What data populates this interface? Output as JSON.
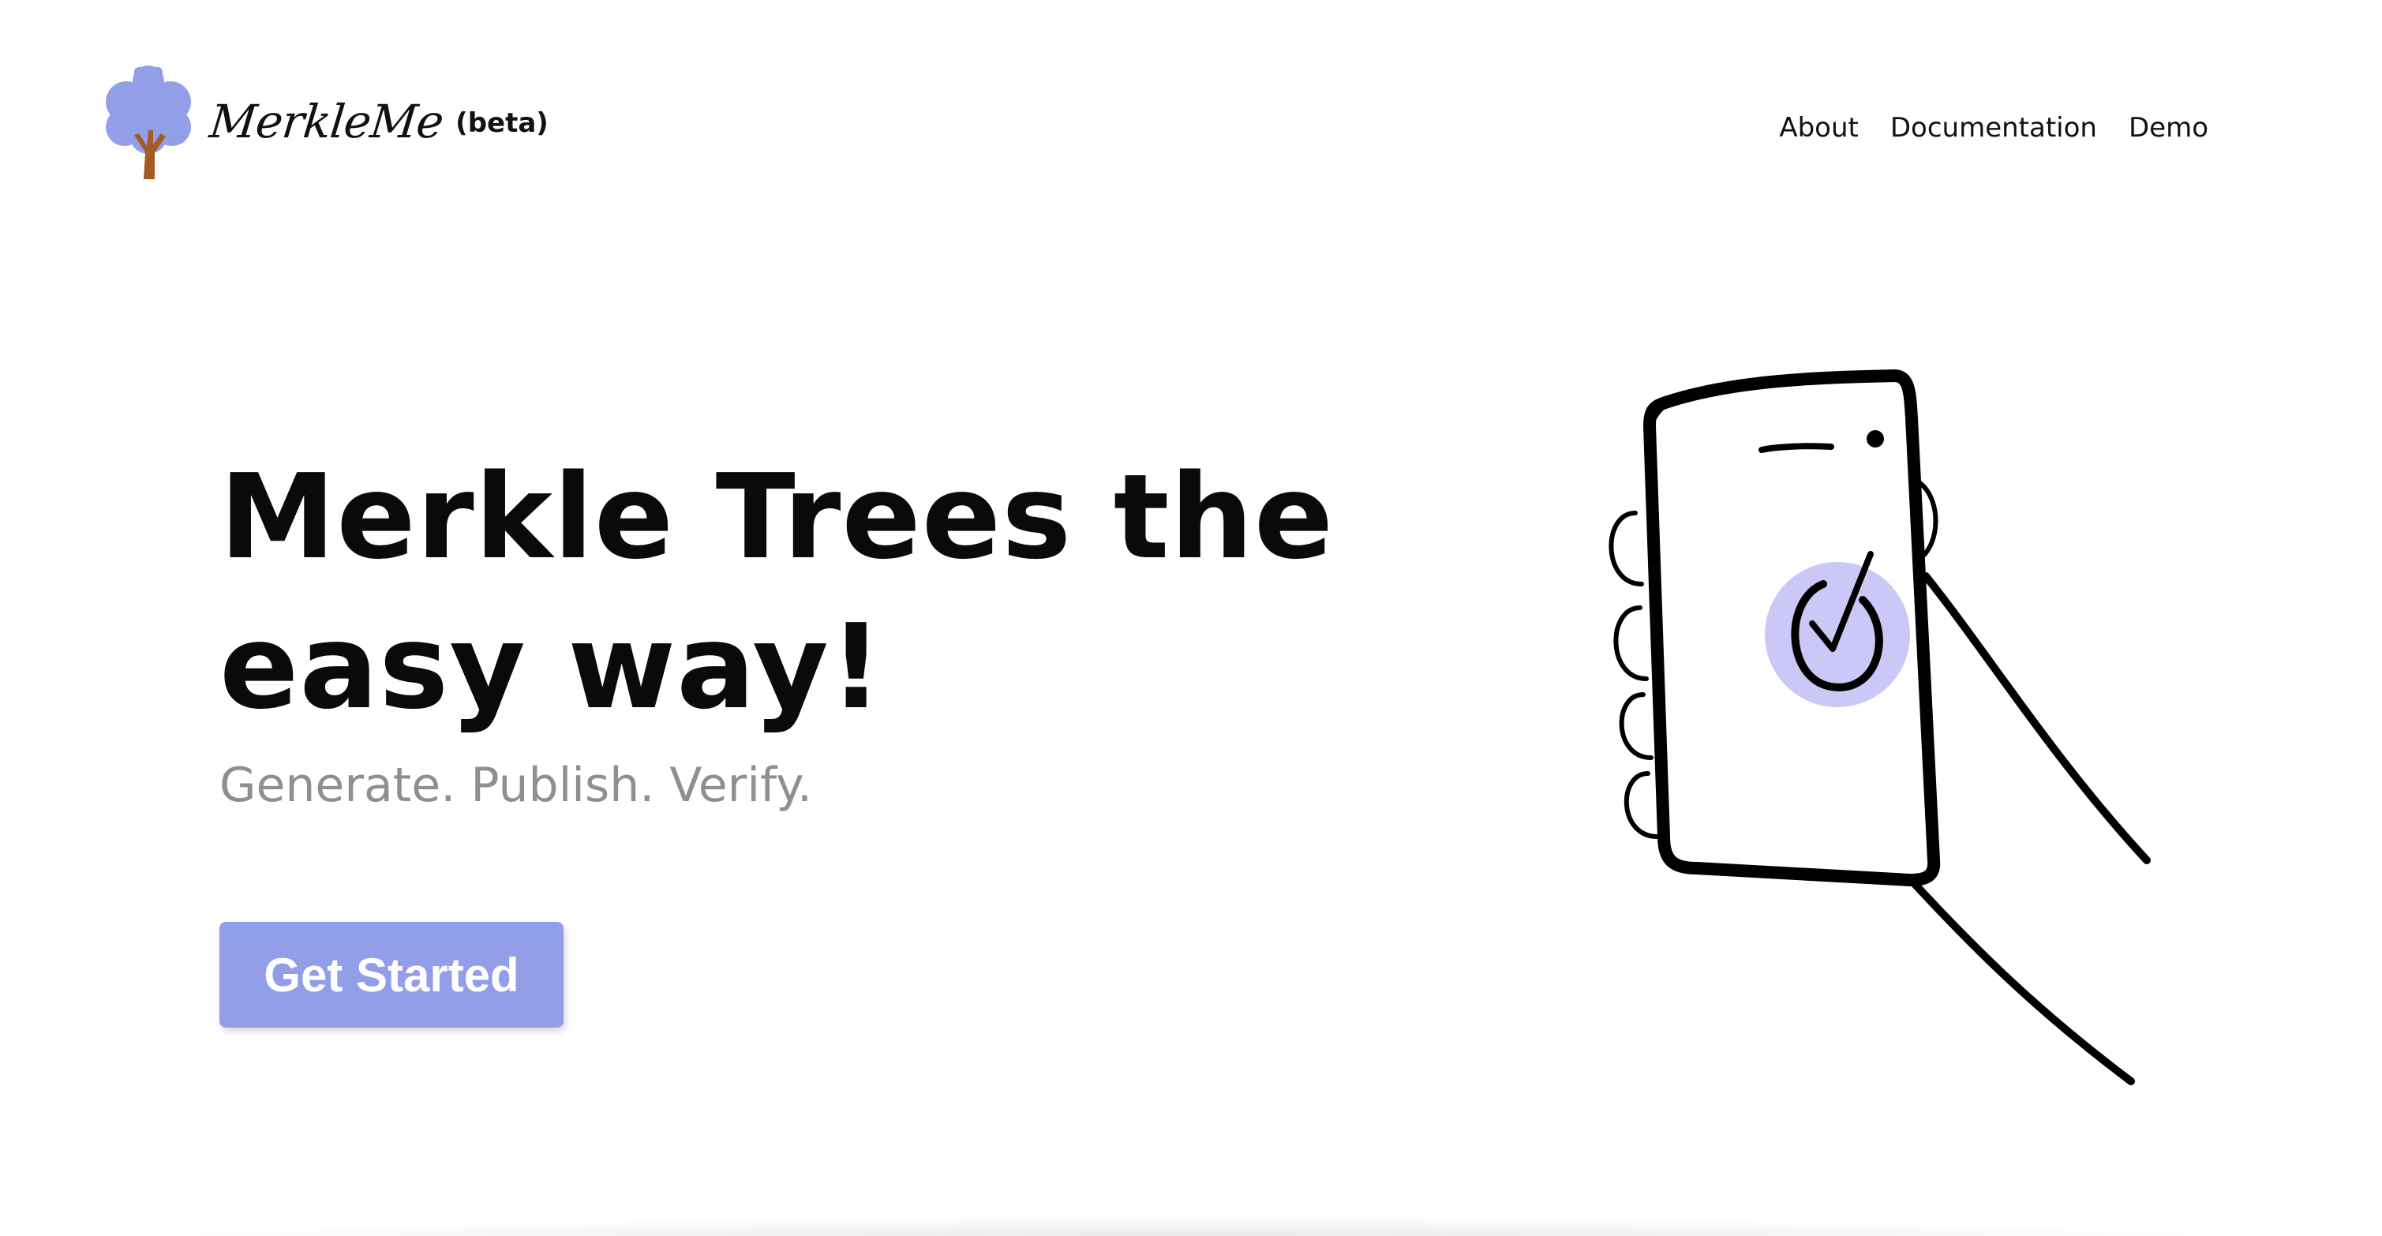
{
  "brand": {
    "name": "MerkleMe",
    "badge": "(beta)"
  },
  "nav": {
    "items": [
      {
        "label": "About"
      },
      {
        "label": "Documentation"
      },
      {
        "label": "Demo"
      }
    ]
  },
  "hero": {
    "title_line1": "Merkle Trees the",
    "title_line2": "easy way!",
    "subtitle": "Generate. Publish. Verify.",
    "cta_label": "Get Started"
  },
  "colors": {
    "accent": "#929fe8",
    "check_circle": "#cbc8f7",
    "tree_trunk": "#a65b25",
    "subtitle_gray": "#8f8f8f"
  },
  "icons": {
    "logo": "tree-icon",
    "illustration": "phone-checkmark-illustration"
  }
}
